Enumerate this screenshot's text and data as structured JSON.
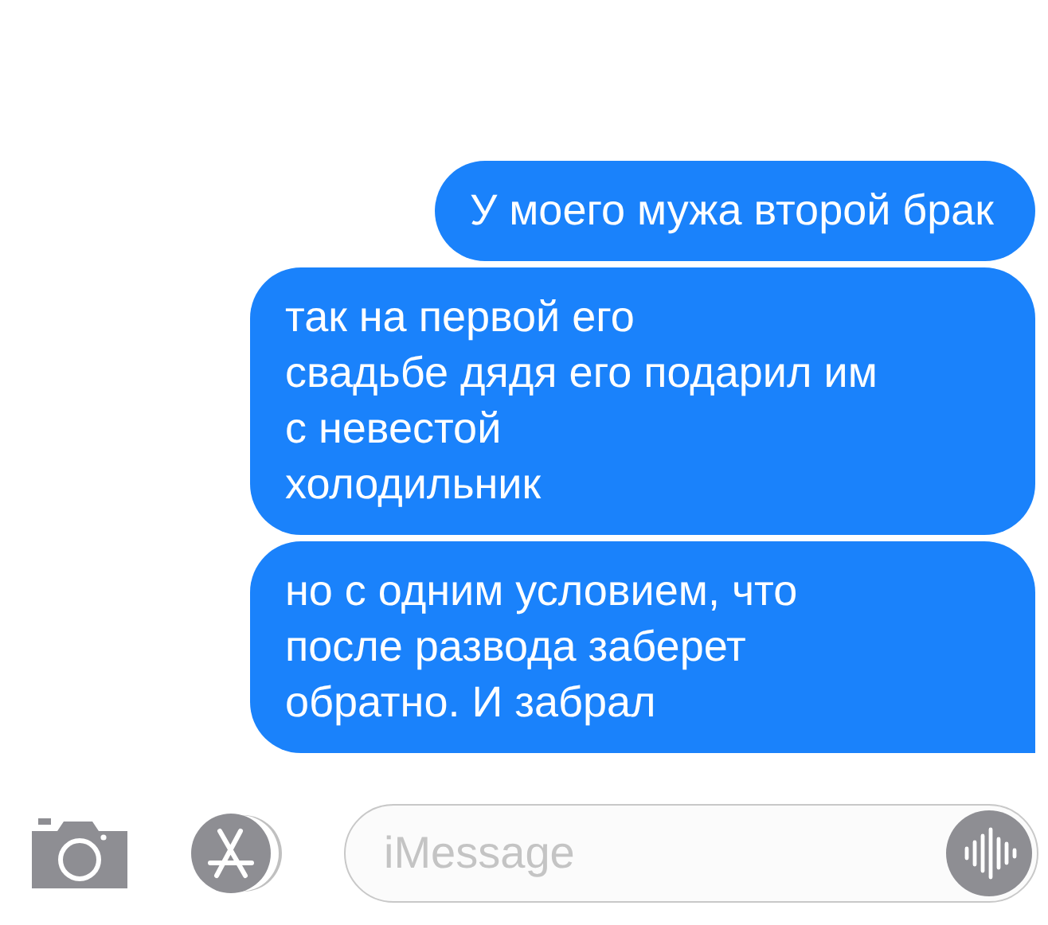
{
  "messages": [
    {
      "lines": [
        "У моего мужа второй брак"
      ],
      "tail": false
    },
    {
      "lines": [
        "так на первой его",
        "свадьбе дядя его подарил им",
        "с невестой",
        "холодильник"
      ],
      "tail": false
    },
    {
      "lines": [
        "но с одним условием, что",
        "после развода заберет",
        "обратно. И забрал"
      ],
      "tail": true
    }
  ],
  "input": {
    "placeholder": "iMessage"
  }
}
